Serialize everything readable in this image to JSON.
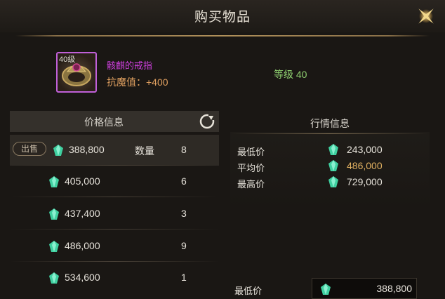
{
  "header": {
    "title": "购买物品"
  },
  "item": {
    "level_badge": "40级",
    "name": "骸麒的戒指",
    "stat": "抗魔值：+400",
    "level_requirement": "等级 40",
    "border_color": "#c060d8"
  },
  "price_panel": {
    "header": "价格信息",
    "sell_label": "出售",
    "quantity_label": "数量",
    "rows": [
      {
        "price": "388,800",
        "qty": "8"
      },
      {
        "price": "405,000",
        "qty": "6"
      },
      {
        "price": "437,400",
        "qty": "3"
      },
      {
        "price": "486,000",
        "qty": "9"
      },
      {
        "price": "534,600",
        "qty": "1"
      }
    ]
  },
  "market_panel": {
    "header": "行情信息",
    "stats": [
      {
        "label": "最低价",
        "value": "243,000"
      },
      {
        "label": "平均价",
        "value": "486,000"
      },
      {
        "label": "最高价",
        "value": "729,000"
      }
    ],
    "bottom_label": "最低价",
    "bottom_value": "388,800"
  },
  "icons": {
    "close": "close-star-icon",
    "refresh": "refresh-icon",
    "currency": "green-gem-icon"
  },
  "colors": {
    "accent_gold": "#b0905a",
    "gem_green": "#3fd0a0",
    "item_name": "#d040e0",
    "stat_orange": "#e0a060",
    "level_green": "#8fd070"
  }
}
